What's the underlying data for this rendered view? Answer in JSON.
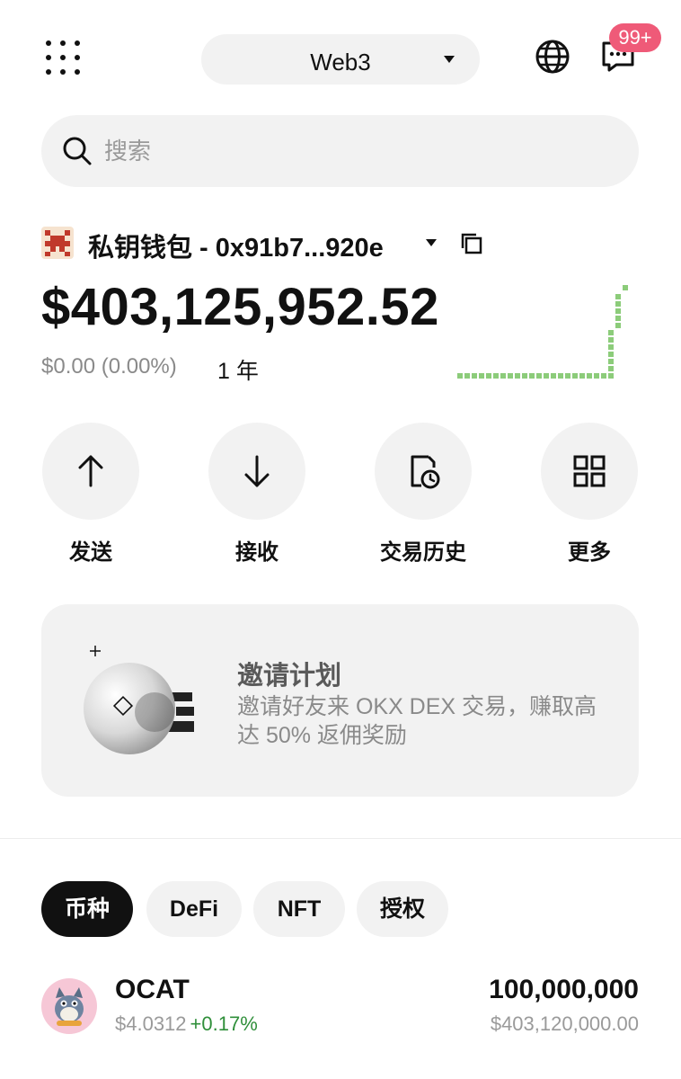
{
  "header": {
    "network_selector": "Web3",
    "notification_count": "99+"
  },
  "search": {
    "placeholder": "搜索"
  },
  "wallet": {
    "name": "私钥钱包 - 0x91b7...920e",
    "balance": "$403,125,952.52",
    "pnl": "$0.00 (0.00%)",
    "period": "1 年",
    "chart_data": {
      "type": "line",
      "color": "#8ccc7a",
      "trend": "flat-then-spike"
    }
  },
  "actions": [
    {
      "label": "发送",
      "icon": "arrow-up-icon"
    },
    {
      "label": "接收",
      "icon": "arrow-down-icon"
    },
    {
      "label": "交易历史",
      "icon": "history-icon"
    },
    {
      "label": "更多",
      "icon": "grid-icon"
    }
  ],
  "promo": {
    "title": "邀请计划",
    "description": "邀请好友来 OKX DEX 交易，赚取高达 50% 返佣奖励"
  },
  "tabs": [
    {
      "label": "币种",
      "active": true
    },
    {
      "label": "DeFi",
      "active": false
    },
    {
      "label": "NFT",
      "active": false
    },
    {
      "label": "授权",
      "active": false
    }
  ],
  "tokens": [
    {
      "symbol": "OCAT",
      "price": "$4.0312",
      "change": "+0.17%",
      "amount": "100,000,000",
      "value": "$403,120,000.00"
    }
  ],
  "colors": {
    "accent_positive": "#2f8f3a",
    "badge": "#ef5a78",
    "surface": "#f2f2f2"
  }
}
